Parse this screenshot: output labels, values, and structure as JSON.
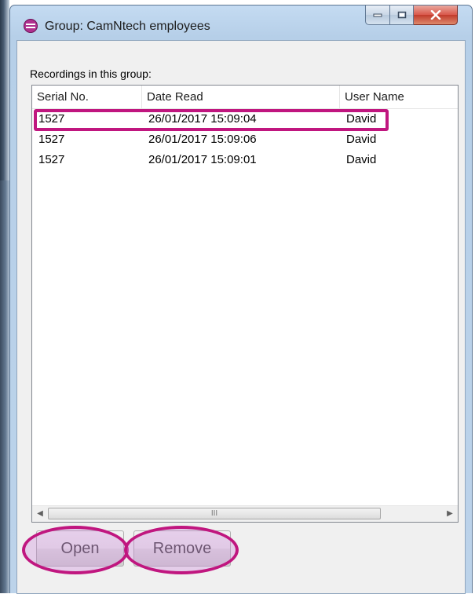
{
  "window": {
    "title": "Group: CamNtech employees",
    "icon": "group-icon",
    "controls": [
      "minimize-icon",
      "maximize-icon",
      "close-icon"
    ]
  },
  "group_label": "Recordings in this group:",
  "table": {
    "columns": [
      "Serial No.",
      "Date Read",
      "User Name"
    ],
    "rows": [
      {
        "serial": "1527",
        "date": "26/01/2017 15:09:04",
        "user": "David"
      },
      {
        "serial": "1527",
        "date": "26/01/2017 15:09:06",
        "user": "David"
      },
      {
        "serial": "1527",
        "date": "26/01/2017 15:09:01",
        "user": "David"
      }
    ]
  },
  "scrollbar": {
    "left_arrow": "◀",
    "right_arrow": "▶",
    "grip": "III"
  },
  "buttons": {
    "open": "Open",
    "remove": "Remove"
  },
  "colors": {
    "annotation": "#c0167f",
    "annotation_fill": "#cd8cdc"
  }
}
